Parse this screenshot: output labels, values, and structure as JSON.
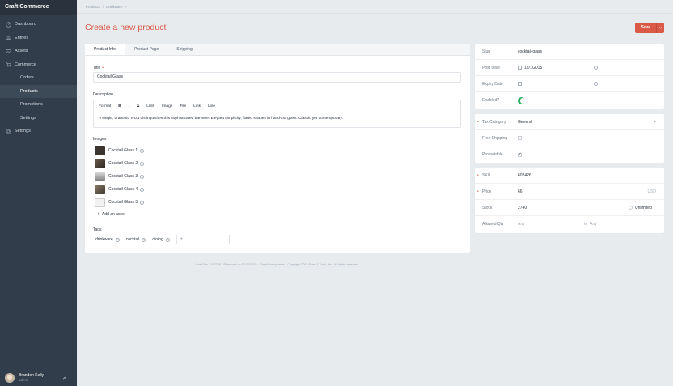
{
  "app": {
    "name": "Craft Commerce"
  },
  "sidebar": {
    "items": [
      {
        "label": "Dashboard",
        "icon": "dashboard-icon"
      },
      {
        "label": "Entries",
        "icon": "entries-icon"
      },
      {
        "label": "Assets",
        "icon": "assets-icon"
      },
      {
        "label": "Commerce",
        "icon": "cart-icon"
      },
      {
        "label": "Orders",
        "icon": ""
      },
      {
        "label": "Products",
        "icon": ""
      },
      {
        "label": "Promotions",
        "icon": ""
      },
      {
        "label": "Settings",
        "icon": ""
      },
      {
        "label": "Settings",
        "icon": "gear-icon"
      }
    ],
    "user": {
      "name": "Brandon Kelly",
      "role": "admin"
    }
  },
  "breadcrumb": {
    "items": [
      "Products",
      "›",
      "Drinkware",
      "›"
    ]
  },
  "page": {
    "title": "Create a new product",
    "save_label": "Save"
  },
  "tabs": [
    "Product Info",
    "Product Page",
    "Shipping"
  ],
  "form": {
    "title_label": "Title",
    "title_value": "Cocktail Glass",
    "description_label": "Description",
    "toolbar": [
      "Format",
      "B",
      "I",
      "S",
      "Lists",
      "Image",
      "File",
      "Link",
      "Line"
    ],
    "description_value": "A single, dramatic V-cut distinguishes this sophisticated barware. Elegant simplicity, flared shapes in hand-cut glass. Classic yet contemporary.",
    "images_label": "Images",
    "images": [
      "Cocktail Glass 1",
      "Cocktail Glass 2",
      "Cocktail Glass 3",
      "Cocktail Glass 4",
      "Cocktail Glass 5"
    ],
    "add_asset_label": "Add an asset",
    "tags_label": "Tags",
    "tags": [
      "drinkware",
      "cocktail",
      "dining"
    ],
    "tag_input_placeholder": "+"
  },
  "meta_panel": {
    "slug_label": "Slug",
    "slug_value": "cocktail-glass",
    "post_date_label": "Post Date",
    "post_date_value": "12/1/2015",
    "expiry_date_label": "Expiry Date",
    "enabled_label": "Enabled?"
  },
  "tax_panel": {
    "tax_category_label": "Tax Category",
    "tax_category_value": "General",
    "free_shipping_label": "Free Shipping",
    "promotable_label": "Promotable"
  },
  "variant_panel": {
    "sku_label": "SKU",
    "sku_value": "602426",
    "price_label": "Price",
    "price_value": "66",
    "price_currency": "USD",
    "stock_label": "Stock",
    "stock_value": "2740",
    "unlimited_label": "Unlimited",
    "allowed_qty_label": "Allowed Qty",
    "allowed_min_placeholder": "Any",
    "allowed_to": "to",
    "allowed_max_placeholder": "Any"
  },
  "footer": {
    "text": "Craft Pro 2.5.2755  ·  Released on 11/24/2015  ·  Check for updates  ·  Copyright 2015 Pixel & Tonic, Inc. All rights reserved."
  },
  "colors": {
    "accent": "#da5a47",
    "sidebar": "#313d4a",
    "success": "#27ae60"
  }
}
